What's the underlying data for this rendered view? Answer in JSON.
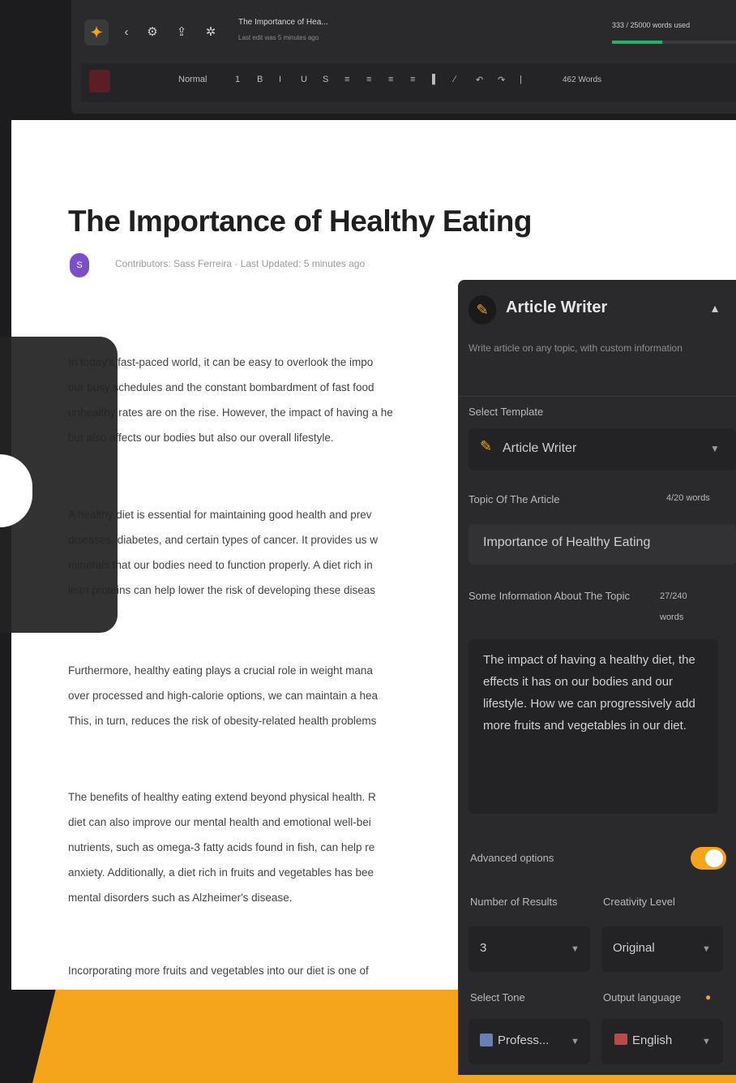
{
  "toolbar": {
    "document_title": "The Importance of Hea... ",
    "document_subtitle": "Last edit was 5 minutes ago",
    "word_count": "333 / 25000 words used",
    "word_progress_fraction": 0.013,
    "format_style": "Normal",
    "words_label": "462 Words",
    "icons": [
      "logo-icon",
      "back-icon",
      "settings-icon",
      "share-icon",
      "gear-icon"
    ],
    "format_buttons": [
      "1",
      "B",
      "I",
      "U",
      "S",
      "≡",
      "≡",
      "≡",
      "≡",
      "▌",
      "⁄",
      "↶",
      "↷",
      "|"
    ]
  },
  "document": {
    "title": "The Importance of Healthy Eating",
    "avatar_letter": "S",
    "meta": "Contributors: Sass Ferreira  ·  Last Updated: 5 minutes ago",
    "paragraphs": [
      [
        "In today's fast-paced world, it can be easy to overlook the impo",
        "our busy schedules and the constant bombardment of fast food",
        "unhealthy rates are on the rise. However, the impact of having a he",
        "but also affects our bodies but also our overall lifestyle."
      ],
      [
        "A healthy diet is essential for maintaining good health and prev",
        "diseases, diabetes, and certain types of cancer. It provides us w",
        "minerals that our bodies need to function properly. A diet rich in",
        "lean proteins can help lower the risk of developing these diseas"
      ],
      [
        "Furthermore, healthy eating plays a crucial role in weight mana",
        "over processed and high-calorie options, we can maintain a hea",
        "This, in turn, reduces the risk of obesity-related health problems"
      ],
      [
        "The benefits of healthy eating extend beyond physical health. R",
        "diet can also improve our mental health and emotional well-bei",
        "nutrients, such as omega-3 fatty acids found in fish, can help re",
        "anxiety. Additionally, a diet rich in fruits and vegetables has bee",
        "mental disorders such as Alzheimer's disease."
      ],
      [
        "Incorporating more fruits and vegetables into our diet is one of"
      ]
    ]
  },
  "panel": {
    "title": "Article Writer",
    "description": "Write article on any topic, with custom information",
    "select_template_label": "Select Template",
    "template_value": "Article Writer",
    "topic_label": "Topic Of The Article",
    "topic_count": "4/20 words",
    "topic_value": "Importance of Healthy Eating",
    "info_label": "Some Information About The Topic",
    "info_count": "27/240 words",
    "info_value": "The impact of having a healthy diet, the effects it has on our bodies and our lifestyle. How we can progressively add more fruits and vegetables in our diet.",
    "advanced_label": "Advanced options",
    "advanced_on": true,
    "results_label": "Number of Results",
    "results_value": "3",
    "creativity_label": "Creativity Level",
    "creativity_value": "Original",
    "tone_label": "Select Tone",
    "tone_value": "Profess...",
    "language_label": "Output language",
    "language_value": "English"
  }
}
